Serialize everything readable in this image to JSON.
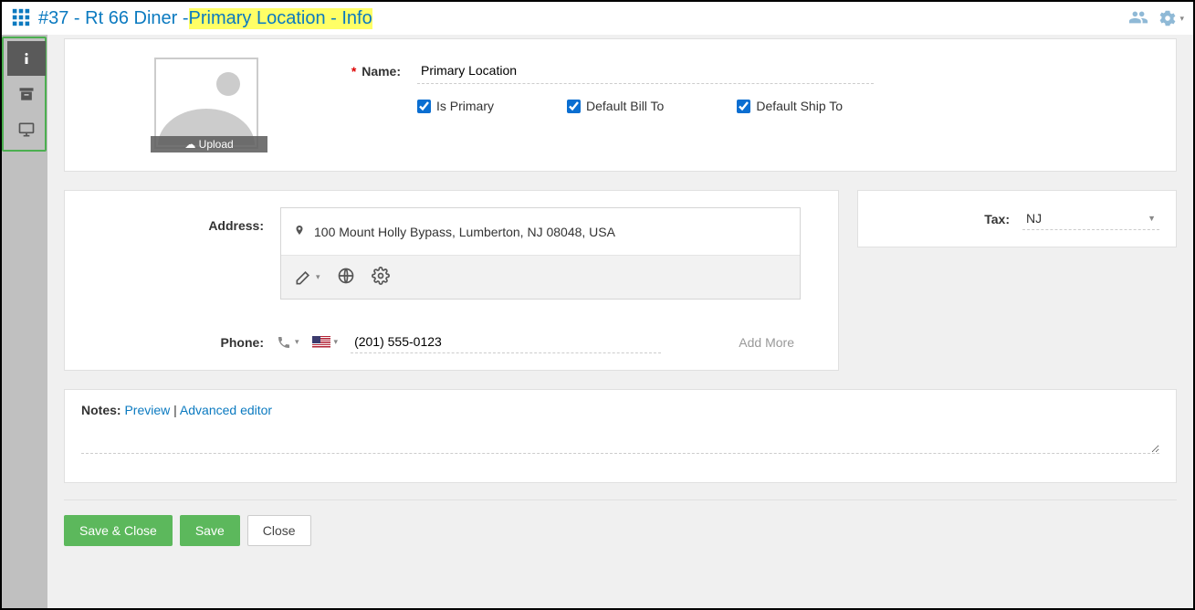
{
  "header": {
    "breadcrumb_prefix": "#37 - Rt 66 Diner - ",
    "breadcrumb_highlight": "Primary Location - Info"
  },
  "sidebar": {
    "tabs": [
      "info",
      "archive",
      "display"
    ]
  },
  "upload": {
    "label": "Upload"
  },
  "form": {
    "name_label": "Name:",
    "name_value": "Primary Location",
    "is_primary_label": "Is Primary",
    "is_primary_checked": true,
    "bill_to_label": "Default Bill To",
    "bill_to_checked": true,
    "ship_to_label": "Default Ship To",
    "ship_to_checked": true
  },
  "address": {
    "label": "Address:",
    "text": "100 Mount Holly Bypass, Lumberton, NJ 08048, USA"
  },
  "phone": {
    "label": "Phone:",
    "value": "(201) 555-0123",
    "add_more": "Add More"
  },
  "tax": {
    "label": "Tax:",
    "value": "NJ"
  },
  "notes": {
    "label": "Notes:",
    "preview": "Preview",
    "sep": " | ",
    "advanced": "Advanced editor"
  },
  "buttons": {
    "save_close": "Save & Close",
    "save": "Save",
    "close": "Close"
  }
}
